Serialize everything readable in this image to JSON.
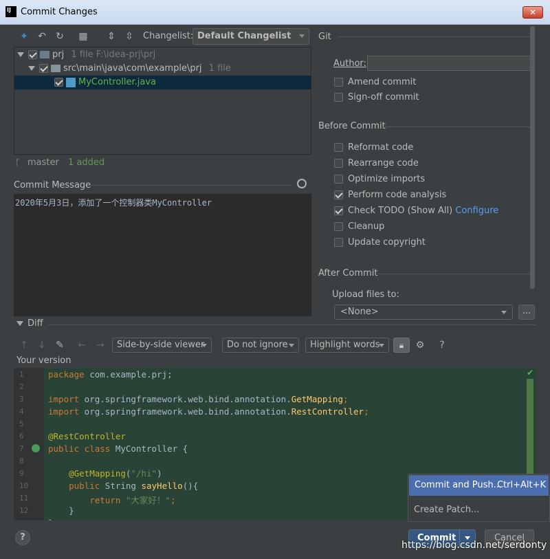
{
  "window": {
    "title": "Commit Changes",
    "app_icon_text": "IJ",
    "close_glyph": "✕"
  },
  "toolbar": {
    "changelist_label": "Changelist:",
    "changelist_value": "Default Changelist"
  },
  "tree": {
    "root": {
      "name": "prj",
      "meta": "1 file  F:\\idea-prj\\prj"
    },
    "folder": {
      "name": "src\\main\\java\\com\\example\\prj",
      "meta": "1 file"
    },
    "file": {
      "name": "MyController.java"
    }
  },
  "status": {
    "branch": "master",
    "added": "1 added"
  },
  "commit_message": {
    "label": "Commit Message",
    "text": "2020年5月3日，添加了一个控制器类MyController"
  },
  "git_panel": {
    "title": "Git",
    "author_label": "Author:",
    "author_value": "",
    "amend": "Amend commit",
    "signoff": "Sign-off commit",
    "before_commit": "Before Commit",
    "options": {
      "reformat": "Reformat code",
      "rearrange": "Rearrange code",
      "optimize": "Optimize imports",
      "analysis": "Perform code analysis",
      "todo": "Check TODO (Show All)",
      "configure": "Configure",
      "cleanup": "Cleanup",
      "copyright": "Update copyright"
    },
    "after_commit": "After Commit",
    "upload_label": "Upload files to:",
    "upload_value": "<None>",
    "more": "..."
  },
  "diff": {
    "title": "Diff",
    "viewer": "Side-by-side viewer",
    "ignore": "Do not ignore",
    "highlight": "Highlight words",
    "help": "?",
    "your_version": "Your version",
    "lines": {
      "n1": "1",
      "n2": "2",
      "n3": "3",
      "n4": "4",
      "n5": "5",
      "n6": "6",
      "n7": "7",
      "n8": "8",
      "n9": "9",
      "n10": "10",
      "n11": "11",
      "n12": "12"
    }
  },
  "popup": {
    "item1": "Commit and Push...",
    "item1_shortcut": "Ctrl+Alt+K",
    "item2": "Create Patch..."
  },
  "buttons": {
    "help": "?",
    "commit": "Commit",
    "cancel": "Cancel"
  },
  "watermark": "https://blog.csdn.net/serdonty"
}
